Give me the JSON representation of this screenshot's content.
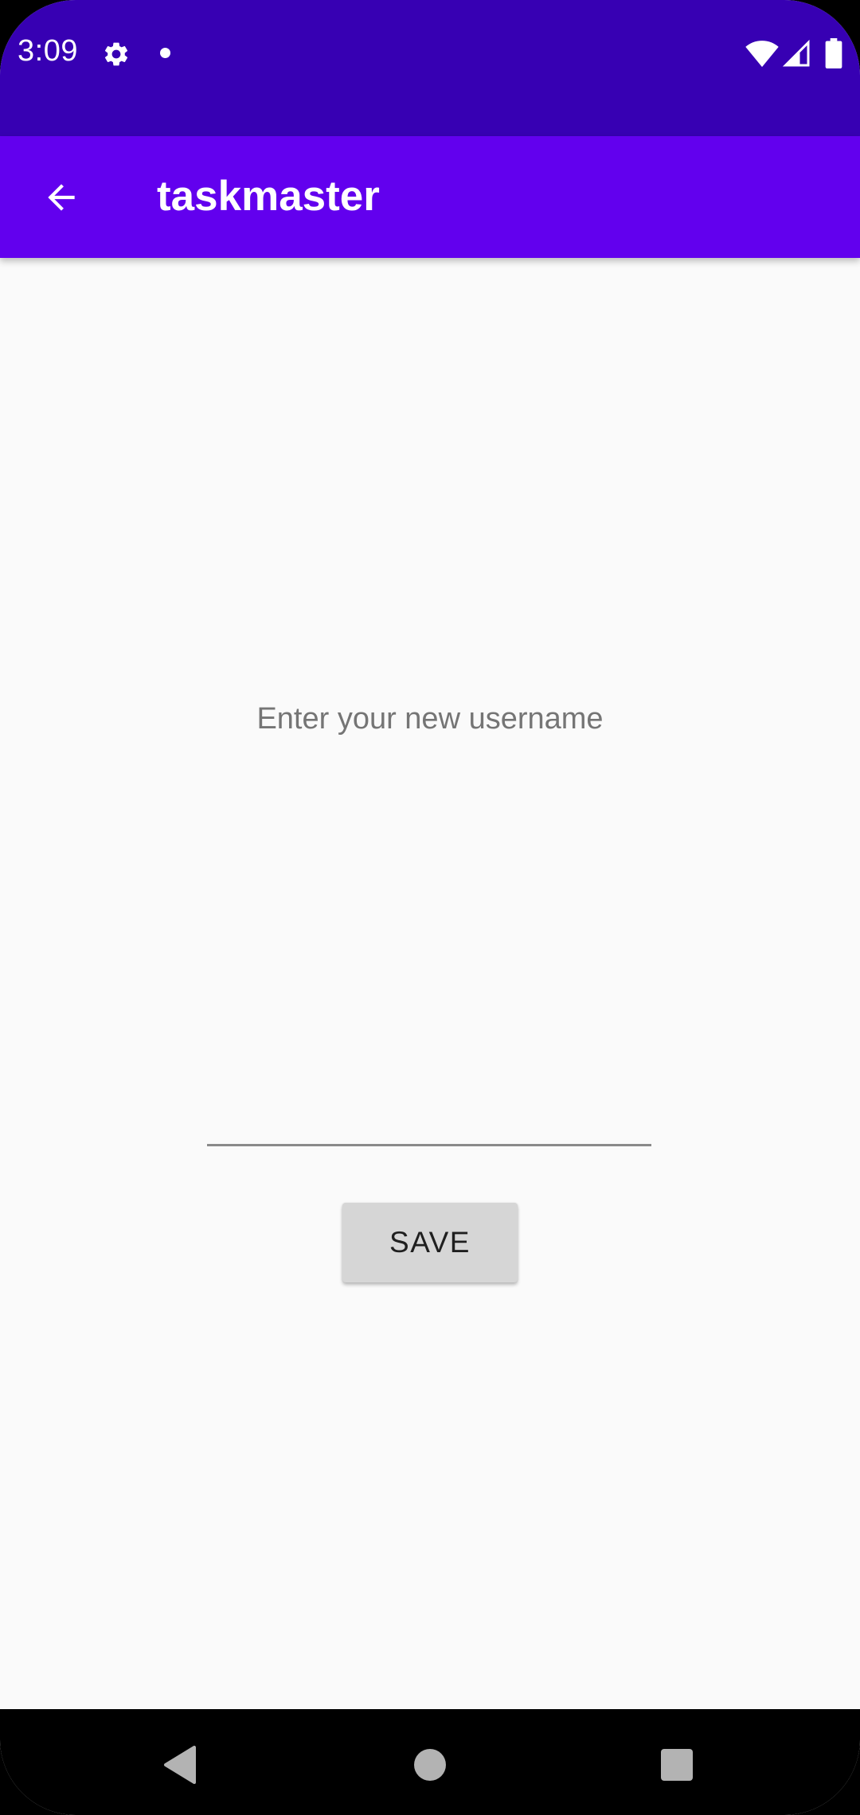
{
  "status_bar": {
    "time": "3:09",
    "background": "#3700b3",
    "icons": [
      "gear-icon",
      "notification-dot-icon",
      "wifi-icon",
      "signal-icon",
      "battery-icon"
    ]
  },
  "app_bar": {
    "title": "taskmaster",
    "background": "#6200ee",
    "back_icon": "arrow-back-icon"
  },
  "form": {
    "prompt": "Enter your new username",
    "username_value": "",
    "save_label": "SAVE"
  },
  "nav_bar": {
    "icons": [
      "nav-back-icon",
      "nav-home-icon",
      "nav-recents-icon"
    ]
  }
}
